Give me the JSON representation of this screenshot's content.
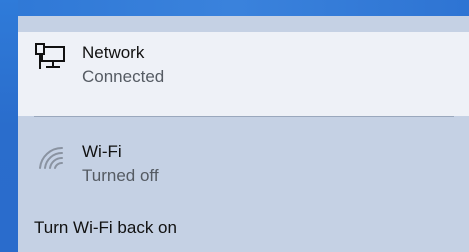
{
  "network": {
    "title": "Network",
    "status": "Connected",
    "icon": "wired-network-icon"
  },
  "wifi": {
    "title": "Wi-Fi",
    "status": "Turned off",
    "icon": "wifi-off-icon",
    "turn_back_on_label": "Turn Wi-Fi back on"
  },
  "colors": {
    "desktop_background": "#2b74d4",
    "flyout_background": "#c5d1e4",
    "selected_row_background": "#eef1f7",
    "primary_text": "#111111",
    "secondary_text": "#555b63"
  }
}
